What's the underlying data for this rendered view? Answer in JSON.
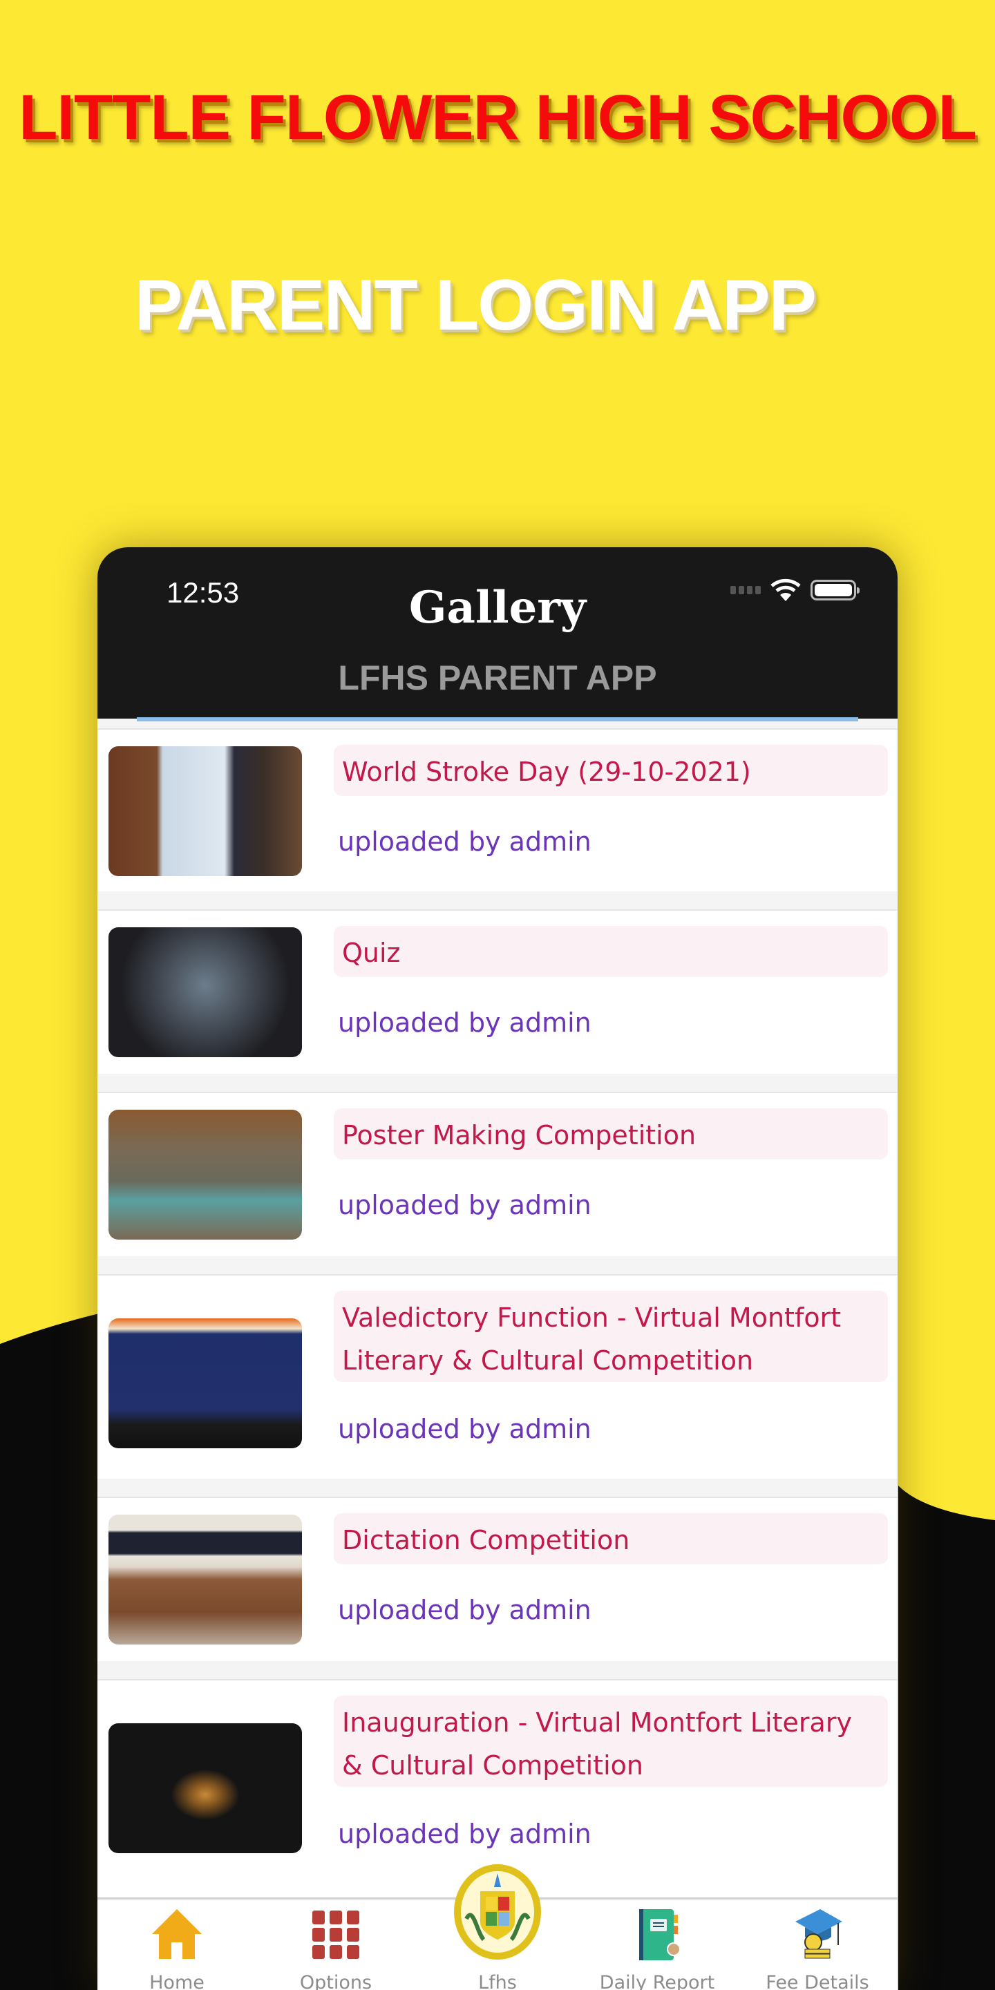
{
  "colors": {
    "background_yellow": "#fde834",
    "promo_title_red": "#f50b0b",
    "header_bg": "#181818",
    "item_title": "#c2184a",
    "item_title_bg": "#fbf0f3",
    "uploader": "#6a35b8",
    "accent_line": "#8bbdeb",
    "nav_label": "#8c8c8c"
  },
  "promo": {
    "title": "LITTLE FLOWER HIGH SCHOOL",
    "subtitle": "PARENT LOGIN APP"
  },
  "status_bar": {
    "time": "12:53",
    "icons": [
      "signal-icon",
      "wifi-icon",
      "battery-icon"
    ]
  },
  "header": {
    "title": "Gallery",
    "subtitle": "LFHS PARENT APP"
  },
  "gallery": {
    "items": [
      {
        "title": "World Stroke Day (29-10-2021)",
        "uploader": "uploaded by admin",
        "image": "presentation-photo"
      },
      {
        "title": "Quiz",
        "uploader": "uploaded by admin",
        "image": "video-call-photo"
      },
      {
        "title": "Poster Making Competition",
        "uploader": "uploaded by admin",
        "image": "students-poster-photo"
      },
      {
        "title": "Valedictory Function - Virtual Montfort Literary & Cultural Competition",
        "uploader": "uploaded by admin",
        "image": "stage-event-photo"
      },
      {
        "title": "Dictation Competition",
        "uploader": "uploaded by admin",
        "image": "classroom-photo"
      },
      {
        "title": "Inauguration - Virtual Montfort Literary & Cultural Competition",
        "uploader": "uploaded by admin",
        "image": "lamp-lighting-photo"
      }
    ]
  },
  "bottom_nav": {
    "items": [
      {
        "label": "Home",
        "icon": "home-icon"
      },
      {
        "label": "Options",
        "icon": "grid-icon"
      },
      {
        "label": "Lfhs",
        "icon": "school-crest-icon"
      },
      {
        "label": "Daily Report",
        "icon": "notebook-icon"
      },
      {
        "label": "Fee Details",
        "icon": "graduation-fee-icon"
      }
    ]
  }
}
